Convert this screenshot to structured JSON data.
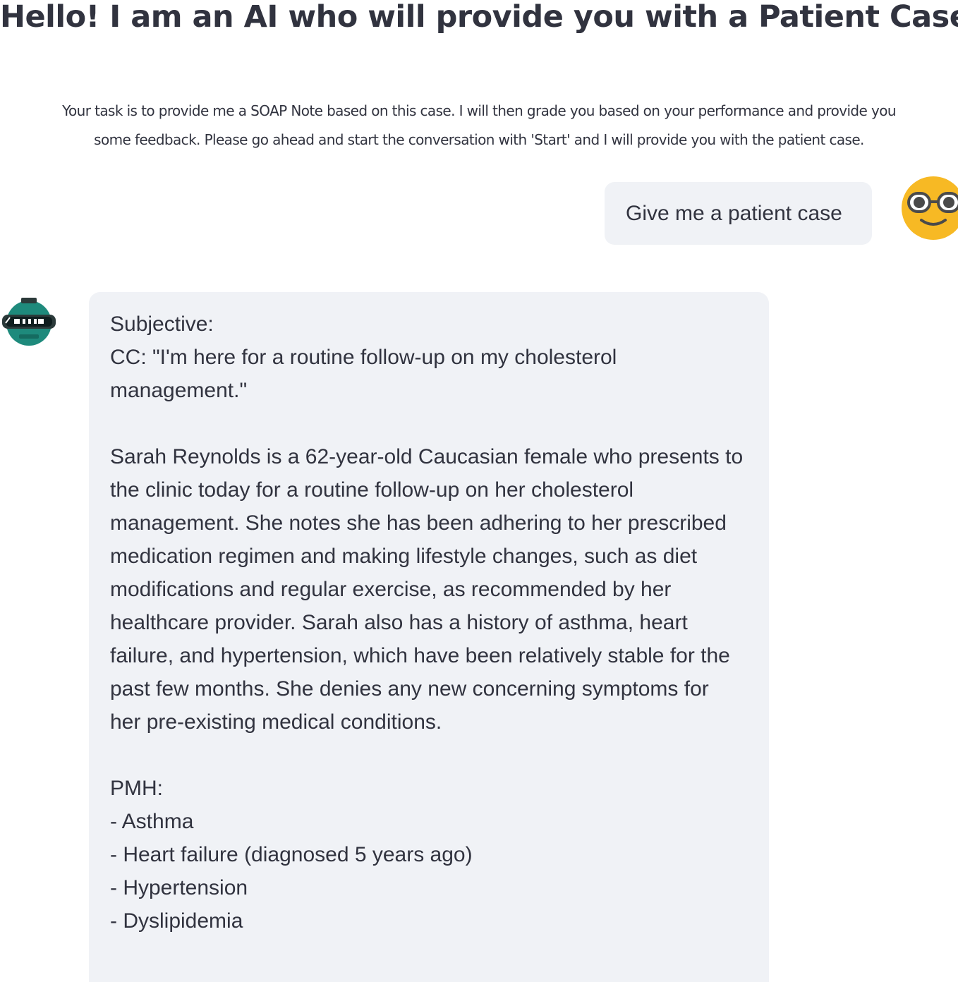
{
  "page": {
    "title": "Hello! I am an AI who will provide you with a Patient Case.",
    "intro_line1": "Your task is to provide me a SOAP Note based on this case. I will then grade you based on your performance and provide you",
    "intro_line2": "some feedback. Please go ahead and start the conversation with 'Start' and I will provide you with the patient case."
  },
  "chat": {
    "user_message": "Give me a patient case",
    "assistant_message": {
      "heading": "Subjective:",
      "cc_line": "CC: \"I'm here for a routine follow-up on my cholesterol management.\"",
      "hpi": "Sarah Reynolds is a 62-year-old Caucasian female who presents to the clinic today for a routine follow-up on her cholesterol management. She notes she has been adhering to her prescribed medication regimen and making lifestyle changes, such as diet modifications and regular exercise, as recommended by her healthcare provider. Sarah also has a history of asthma, heart failure, and hypertension, which have been relatively stable for the past few months. She denies any new concerning symptoms for her pre-existing medical conditions.",
      "pmh_heading": "PMH:",
      "pmh_items": [
        "- Asthma",
        "- Heart failure (diagnosed 5 years ago)",
        "- Hypertension",
        "- Dyslipidemia"
      ]
    }
  },
  "icons": {
    "user_avatar": "nerd-face-icon",
    "bot_avatar": "robot-icon"
  },
  "colors": {
    "bubble_bg": "#f0f2f6",
    "text": "#31333f",
    "user_avatar": "#f7b924",
    "bot_avatar": "#1e8a7c"
  }
}
